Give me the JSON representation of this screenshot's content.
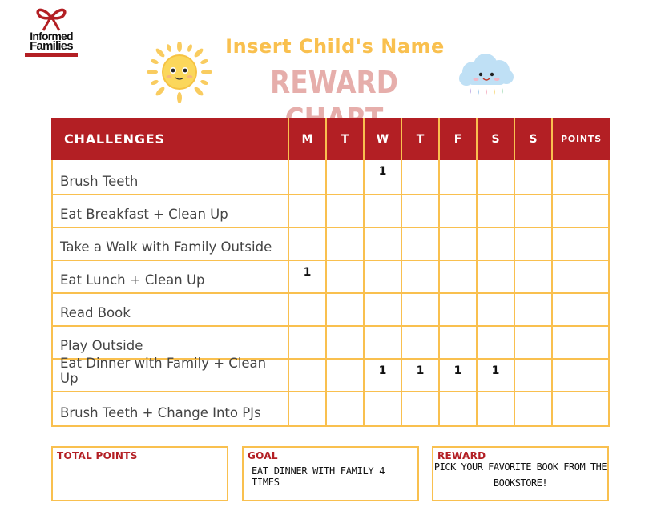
{
  "logo": {
    "line1": "Informed",
    "line2": "Families",
    "brand_color": "#b31f24"
  },
  "header": {
    "child_name": "Insert Child's Name",
    "title": "REWARD CHART",
    "icons": [
      "sun-icon",
      "cloud-icon"
    ]
  },
  "colors": {
    "header_bg": "#b31f24",
    "grid_line": "#f9c04f",
    "name_color": "#f9c04f",
    "title_color": "#e6aeab"
  },
  "table": {
    "columns": {
      "challenges": "CHALLENGES",
      "days": [
        "M",
        "T",
        "W",
        "T",
        "F",
        "S",
        "S"
      ],
      "points": "POINTS"
    },
    "rows": [
      {
        "challenge": "Brush Teeth",
        "marks": [
          "",
          "",
          "1",
          "",
          "",
          "",
          ""
        ],
        "points": ""
      },
      {
        "challenge": "Eat Breakfast + Clean Up",
        "marks": [
          "",
          "",
          "",
          "",
          "",
          "",
          ""
        ],
        "points": ""
      },
      {
        "challenge": "Take a Walk with Family Outside",
        "marks": [
          "",
          "",
          "",
          "",
          "",
          "",
          ""
        ],
        "points": ""
      },
      {
        "challenge": "Eat Lunch + Clean Up",
        "marks": [
          "1",
          "",
          "",
          "",
          "",
          "",
          ""
        ],
        "points": ""
      },
      {
        "challenge": "Read Book",
        "marks": [
          "",
          "",
          "",
          "",
          "",
          "",
          ""
        ],
        "points": ""
      },
      {
        "challenge": "Play Outside",
        "marks": [
          "",
          "",
          "",
          "",
          "",
          "",
          ""
        ],
        "points": ""
      },
      {
        "challenge": "Eat Dinner with Family + Clean Up",
        "marks": [
          "",
          "",
          "1",
          "1",
          "1",
          "1",
          ""
        ],
        "points": ""
      },
      {
        "challenge": "Brush Teeth + Change Into PJs",
        "marks": [
          "",
          "",
          "",
          "",
          "",
          "",
          ""
        ],
        "points": ""
      }
    ]
  },
  "footer": {
    "total_points": {
      "label": "TOTAL POINTS",
      "value": ""
    },
    "goal": {
      "label": "GOAL",
      "value": "EAT DINNER WITH FAMILY 4 TIMES"
    },
    "reward": {
      "label": "REWARD",
      "value_line1": "PICK YOUR FAVORITE BOOK FROM THE",
      "value_line2": "BOOKSTORE!"
    }
  }
}
